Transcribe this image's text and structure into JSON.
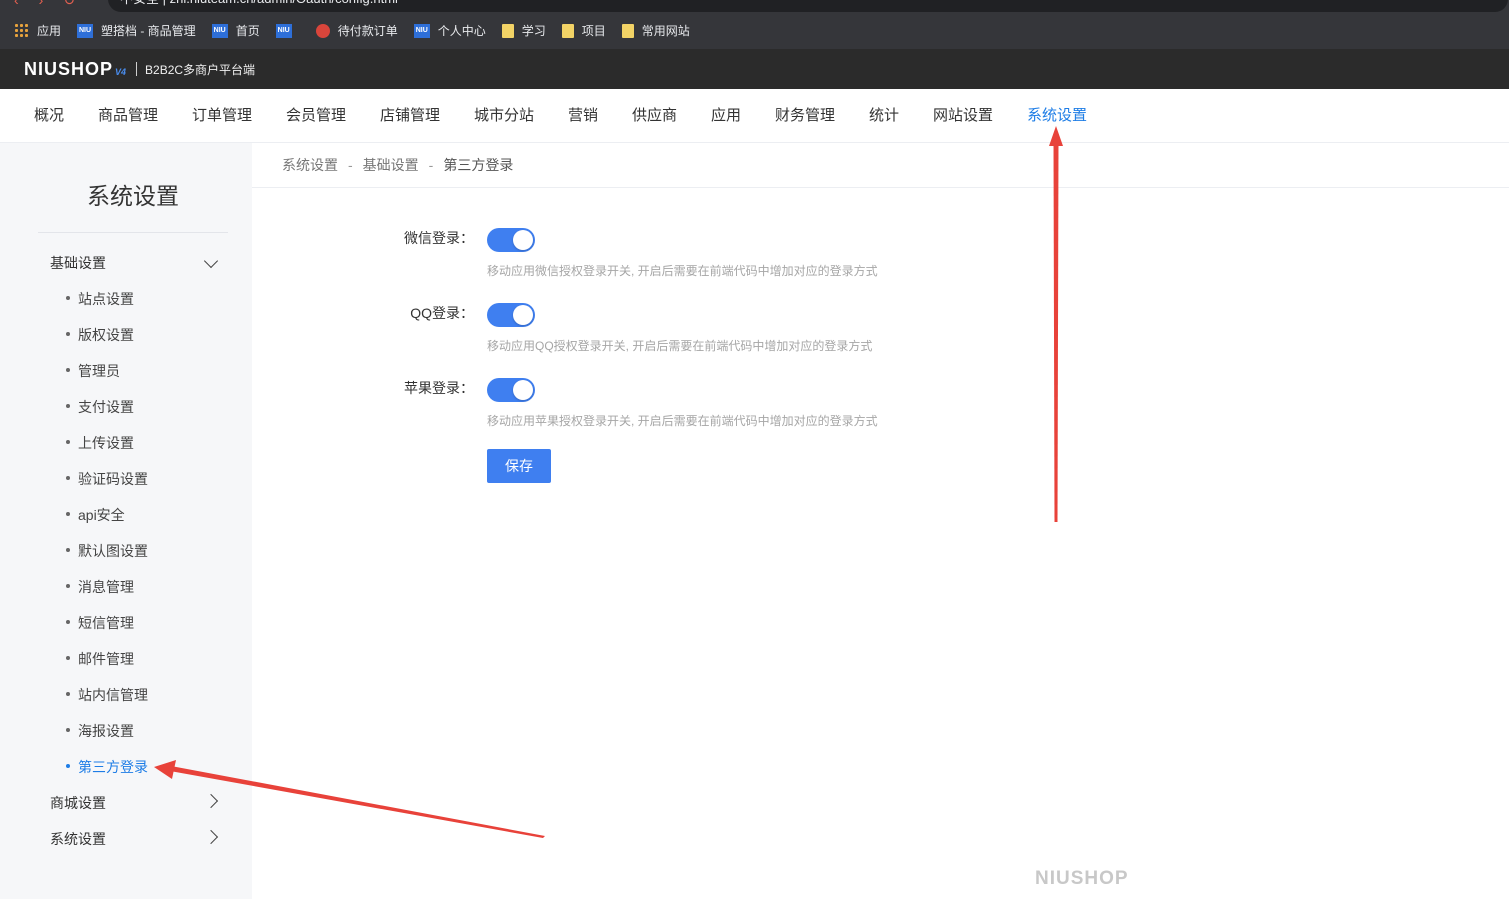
{
  "browser": {
    "address": "不安全 | zhi.niuteam.cn/admin/Oauth/config.html"
  },
  "bookmarks": [
    {
      "label": "应用",
      "icon": "apps-grid-icon"
    },
    {
      "label": "塑搭档 - 商品管理",
      "icon": "niu-favicon-icon"
    },
    {
      "label": "首页",
      "icon": "niu-favicon-icon"
    },
    {
      "label": "",
      "icon": "niu-favicon-icon"
    },
    {
      "label": "待付款订单",
      "icon": "red-globe-icon"
    },
    {
      "label": "个人中心",
      "icon": "niu-favicon-icon"
    },
    {
      "label": "学习",
      "icon": "folder-icon"
    },
    {
      "label": "项目",
      "icon": "folder-icon"
    },
    {
      "label": "常用网站",
      "icon": "folder-icon"
    }
  ],
  "header": {
    "logo": "NIUSHOP",
    "logo_version": "V4",
    "platform": "B2B2C多商户平台端"
  },
  "main_nav": [
    {
      "label": "概况"
    },
    {
      "label": "商品管理"
    },
    {
      "label": "订单管理"
    },
    {
      "label": "会员管理"
    },
    {
      "label": "店铺管理"
    },
    {
      "label": "城市分站"
    },
    {
      "label": "营销"
    },
    {
      "label": "供应商"
    },
    {
      "label": "应用"
    },
    {
      "label": "财务管理"
    },
    {
      "label": "统计"
    },
    {
      "label": "网站设置"
    },
    {
      "label": "系统设置",
      "active": true
    }
  ],
  "sidebar": {
    "title": "系统设置",
    "groups": [
      {
        "label": "基础设置",
        "expanded": true
      },
      {
        "label": "商城设置",
        "expanded": false
      },
      {
        "label": "系统设置",
        "expanded": false
      }
    ],
    "items": [
      {
        "label": "站点设置"
      },
      {
        "label": "版权设置"
      },
      {
        "label": "管理员"
      },
      {
        "label": "支付设置"
      },
      {
        "label": "上传设置"
      },
      {
        "label": "验证码设置"
      },
      {
        "label": "api安全"
      },
      {
        "label": "默认图设置"
      },
      {
        "label": "消息管理"
      },
      {
        "label": "短信管理"
      },
      {
        "label": "邮件管理"
      },
      {
        "label": "站内信管理"
      },
      {
        "label": "海报设置"
      },
      {
        "label": "第三方登录",
        "active": true
      }
    ]
  },
  "breadcrumb": [
    "系统设置",
    "基础设置",
    "第三方登录"
  ],
  "breadcrumb_separator": "-",
  "form": {
    "fields": [
      {
        "label": "微信登录：",
        "enabled": true,
        "hint": "移动应用微信授权登录开关, 开启后需要在前端代码中增加对应的登录方式"
      },
      {
        "label": "QQ登录：",
        "enabled": true,
        "hint": "移动应用QQ授权登录开关, 开启后需要在前端代码中增加对应的登录方式"
      },
      {
        "label": "苹果登录：",
        "enabled": true,
        "hint": "移动应用苹果授权登录开关, 开启后需要在前端代码中增加对应的登录方式"
      }
    ],
    "save_label": "保存"
  },
  "footer": {
    "logo": "NIUSHOP"
  },
  "colors": {
    "accent": "#1e7de6",
    "toggle_on": "#3f7ff0",
    "annotation_arrow": "#e8423a",
    "admin_bar": "#2b2b2b",
    "sidebar_bg": "#f6f7f9"
  }
}
